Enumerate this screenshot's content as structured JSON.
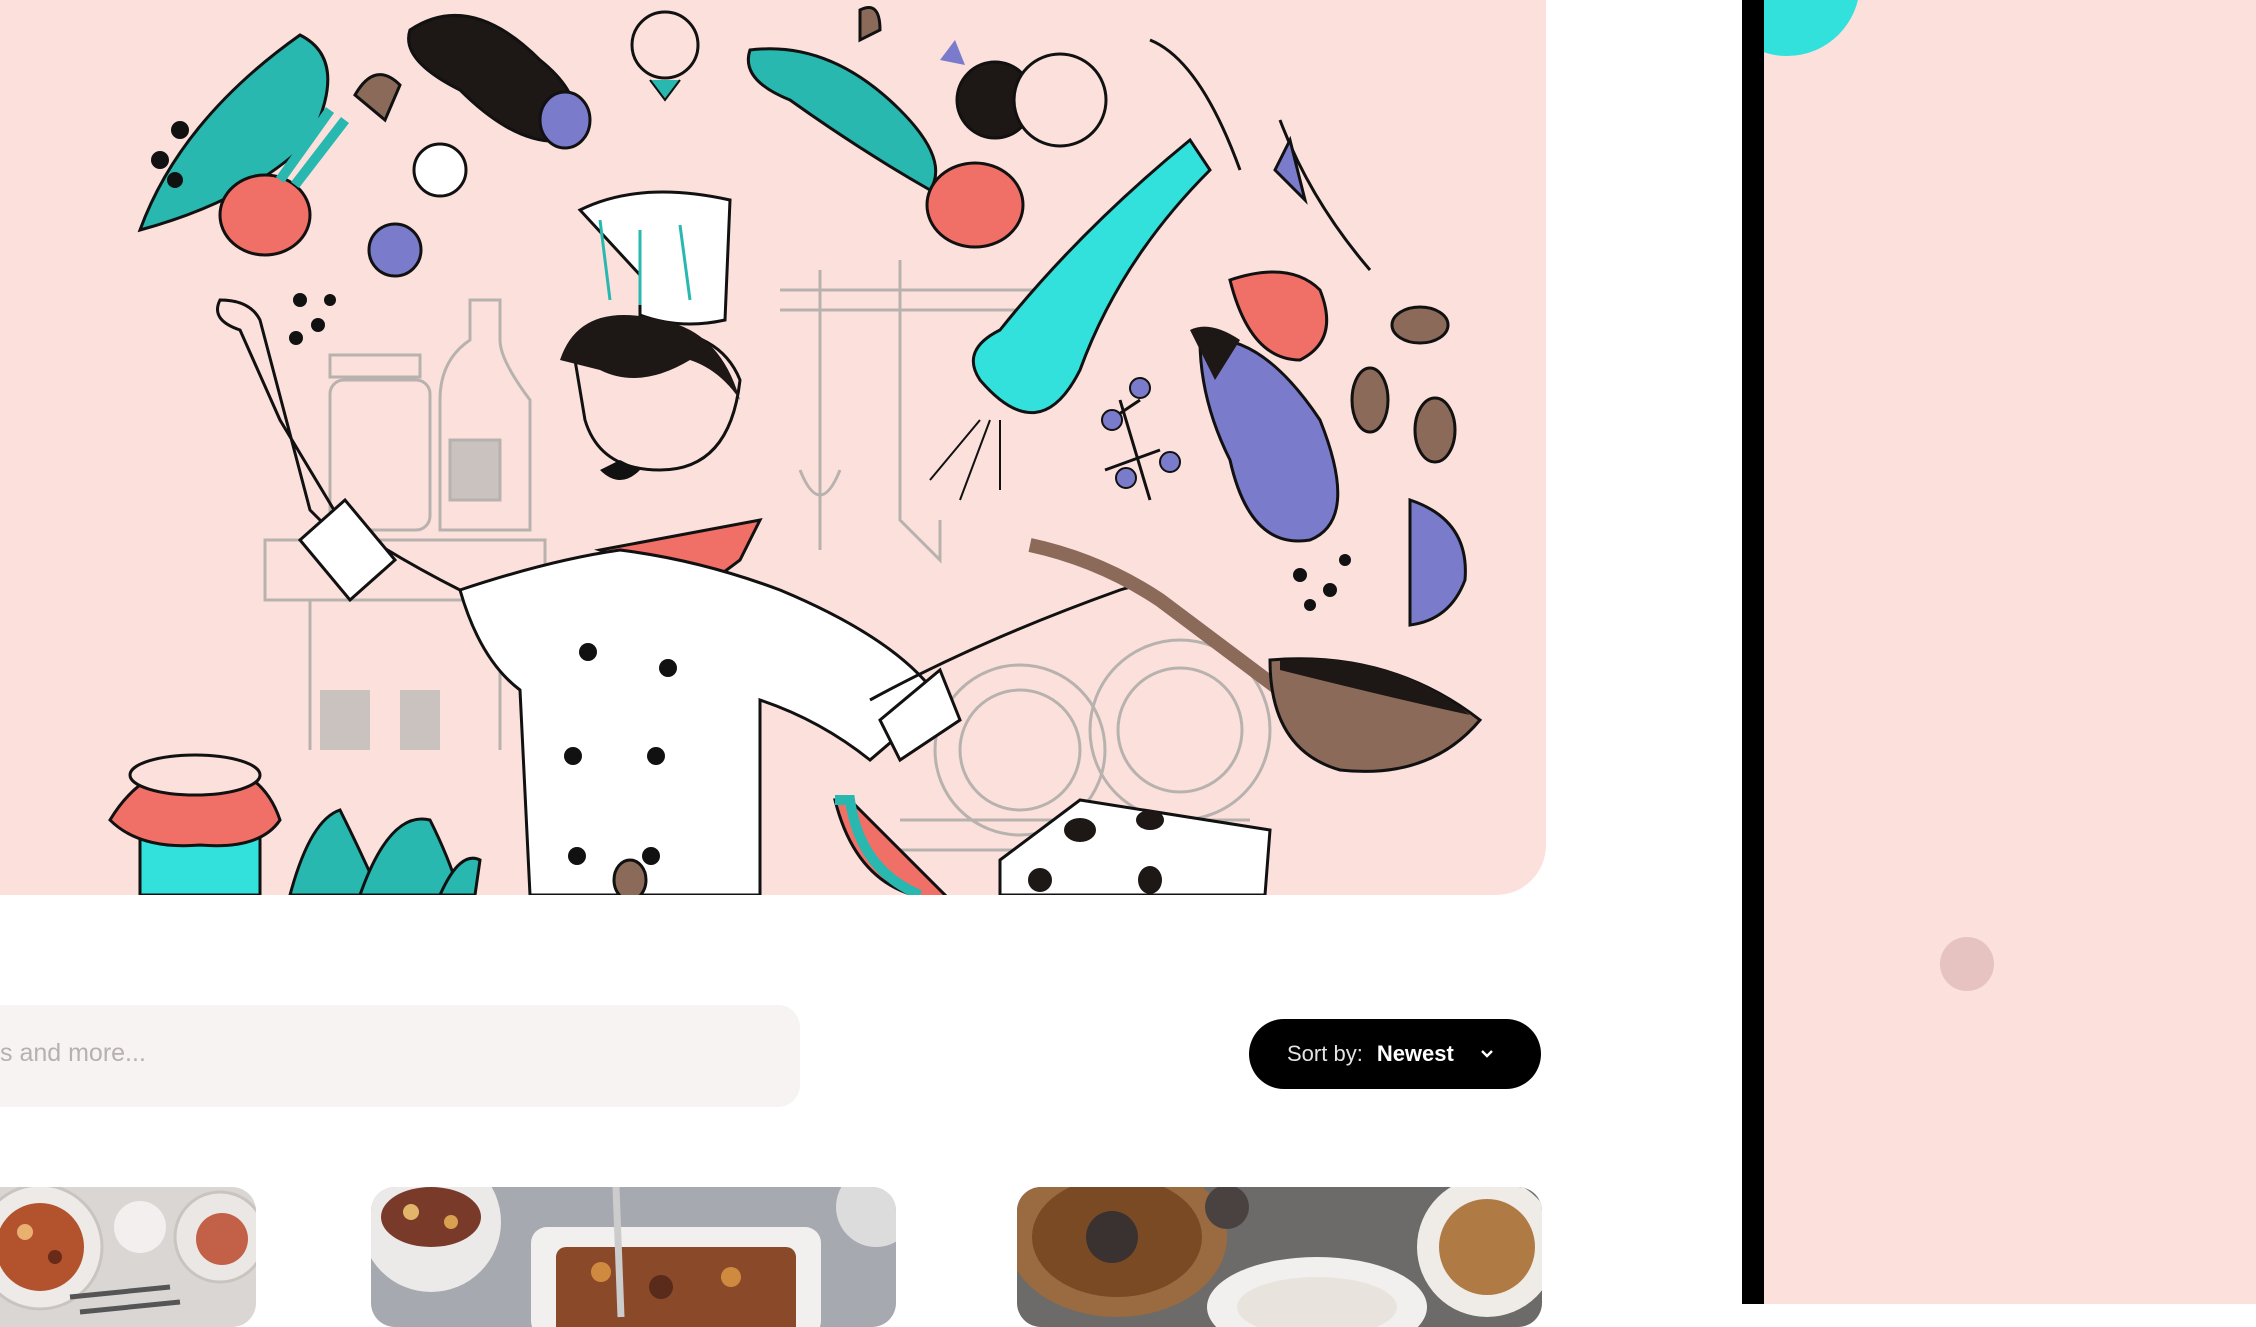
{
  "search": {
    "placeholder": "s and more..."
  },
  "sort": {
    "label": "Sort by:",
    "value": "Newest"
  },
  "cards": [
    {
      "name": "recipe-card-1"
    },
    {
      "name": "recipe-card-2"
    },
    {
      "name": "recipe-card-3"
    }
  ],
  "colors": {
    "hero_bg": "#fbe0dc",
    "accent_teal": "#32e1dc",
    "accent_coral": "#f07068",
    "accent_violet": "#7b7bcc",
    "button_bg": "#000000"
  },
  "icons": [
    "chef-illustration",
    "chevron-down-icon"
  ]
}
